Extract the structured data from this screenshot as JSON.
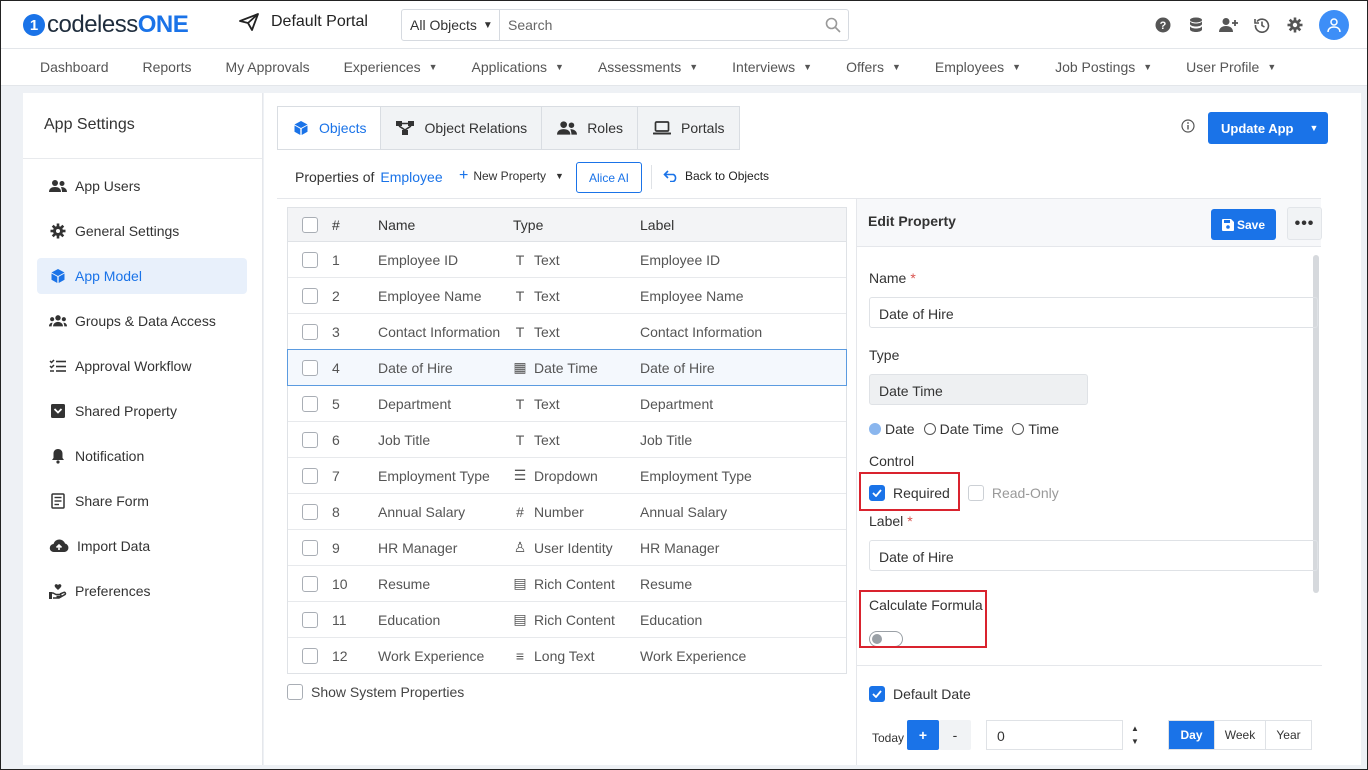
{
  "brand": {
    "logo_mark": "1",
    "name_part1": "codeless",
    "name_part2": "ONE"
  },
  "portal": {
    "name": "Default Portal",
    "icon": "paper-plane-icon"
  },
  "search": {
    "scope": "All Objects",
    "placeholder": "Search"
  },
  "top_icons": [
    "help-icon",
    "database-icon",
    "add-user-icon",
    "history-icon",
    "gear-icon",
    "user-avatar-icon"
  ],
  "nav": {
    "items": [
      {
        "label": "Dashboard",
        "dropdown": false
      },
      {
        "label": "Reports",
        "dropdown": false
      },
      {
        "label": "My Approvals",
        "dropdown": false
      },
      {
        "label": "Experiences",
        "dropdown": true
      },
      {
        "label": "Applications",
        "dropdown": true
      },
      {
        "label": "Assessments",
        "dropdown": true
      },
      {
        "label": "Interviews",
        "dropdown": true
      },
      {
        "label": "Offers",
        "dropdown": true
      },
      {
        "label": "Employees",
        "dropdown": true
      },
      {
        "label": "Job Postings",
        "dropdown": true
      },
      {
        "label": "User Profile",
        "dropdown": true
      }
    ]
  },
  "sidebar": {
    "title": "App Settings",
    "items": [
      {
        "label": "App Users",
        "icon": "users-icon"
      },
      {
        "label": "General Settings",
        "icon": "gear-icon"
      },
      {
        "label": "App Model",
        "icon": "cube-icon",
        "active": true
      },
      {
        "label": "Groups & Data Access",
        "icon": "group-icon"
      },
      {
        "label": "Approval Workflow",
        "icon": "checklist-icon"
      },
      {
        "label": "Shared Property",
        "icon": "inbox-icon"
      },
      {
        "label": "Notification",
        "icon": "bell-icon"
      },
      {
        "label": "Share Form",
        "icon": "form-icon"
      },
      {
        "label": "Import Data",
        "icon": "cloud-upload-icon"
      },
      {
        "label": "Preferences",
        "icon": "hand-heart-icon"
      }
    ]
  },
  "tabs": [
    {
      "label": "Objects",
      "icon": "cube-icon",
      "active": true
    },
    {
      "label": "Object Relations",
      "icon": "relations-icon"
    },
    {
      "label": "Roles",
      "icon": "users-icon"
    },
    {
      "label": "Portals",
      "icon": "laptop-icon"
    }
  ],
  "update_app_label": "Update App",
  "subbar": {
    "properties_of": "Properties of",
    "object": "Employee",
    "new_property": "New Property",
    "alice_ai": "Alice AI",
    "back": "Back to Objects"
  },
  "table": {
    "headers": {
      "num": "#",
      "name": "Name",
      "type": "Type",
      "label": "Label"
    },
    "rows": [
      {
        "num": "1",
        "name": "Employee ID",
        "type": "Text",
        "type_icon": "T",
        "label": "Employee ID"
      },
      {
        "num": "2",
        "name": "Employee Name",
        "type": "Text",
        "type_icon": "T",
        "label": "Employee Name"
      },
      {
        "num": "3",
        "name": "Contact Information",
        "type": "Text",
        "type_icon": "T",
        "label": "Contact Information"
      },
      {
        "num": "4",
        "name": "Date of Hire",
        "type": "Date Time",
        "type_icon": "▦",
        "label": "Date of Hire",
        "selected": true
      },
      {
        "num": "5",
        "name": "Department",
        "type": "Text",
        "type_icon": "T",
        "label": "Department"
      },
      {
        "num": "6",
        "name": "Job Title",
        "type": "Text",
        "type_icon": "T",
        "label": "Job Title"
      },
      {
        "num": "7",
        "name": "Employment Type",
        "type": "Dropdown",
        "type_icon": "☰",
        "label": "Employment Type"
      },
      {
        "num": "8",
        "name": "Annual Salary",
        "type": "Number",
        "type_icon": "#",
        "label": "Annual Salary"
      },
      {
        "num": "9",
        "name": "HR Manager",
        "type": "User Identity",
        "type_icon": "♙",
        "label": "HR Manager"
      },
      {
        "num": "10",
        "name": "Resume",
        "type": "Rich Content",
        "type_icon": "▤",
        "label": "Resume"
      },
      {
        "num": "11",
        "name": "Education",
        "type": "Rich Content",
        "type_icon": "▤",
        "label": "Education"
      },
      {
        "num": "12",
        "name": "Work Experience",
        "type": "Long Text",
        "type_icon": "≡",
        "label": "Work Experience"
      }
    ]
  },
  "show_system_properties": "Show System Properties",
  "edit": {
    "title": "Edit Property",
    "save": "Save",
    "more": "•••",
    "name_label": "Name",
    "name_value": "Date of Hire",
    "type_label": "Type",
    "type_value": "Date Time",
    "radio_options": [
      "Date",
      "Date Time",
      "Time"
    ],
    "radio_selected": "Date",
    "control_label": "Control",
    "required": "Required",
    "read_only": "Read-Only",
    "label_label": "Label",
    "label_value": "Date of Hire",
    "calculate_formula": "Calculate Formula",
    "default_date": "Default Date",
    "today": "Today",
    "plus": "+",
    "minus": "-",
    "offset_value": "0",
    "units": [
      "Day",
      "Week",
      "Year"
    ],
    "unit_selected": "Day"
  },
  "colors": {
    "accent": "#1a73e8",
    "highlight": "#d9232e"
  }
}
